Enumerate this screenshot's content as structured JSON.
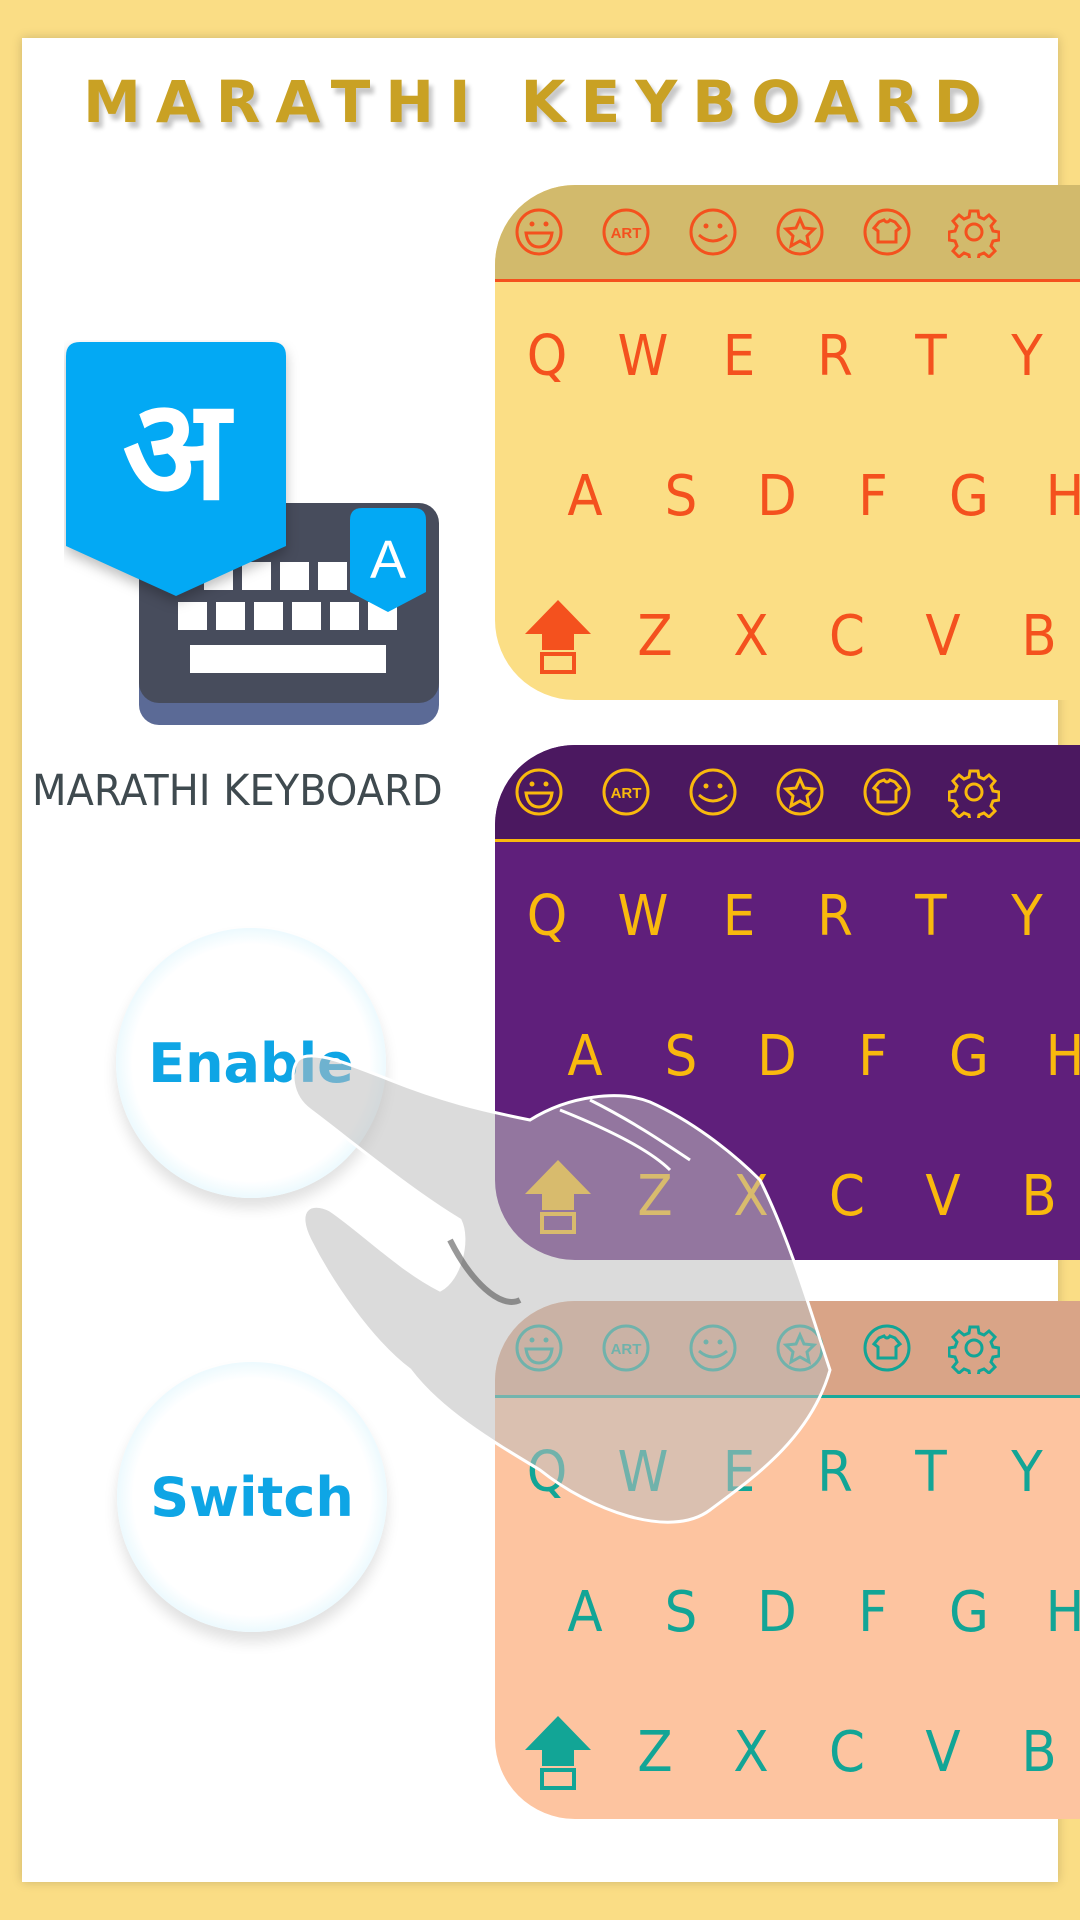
{
  "header": {
    "title": "MARATHI KEYBOARD"
  },
  "app": {
    "name": "MARATHI KEYBOARD",
    "logo": {
      "devanagari_glyph": "अ",
      "latin_glyph": "A"
    }
  },
  "buttons": {
    "enable": "Enable",
    "switch": "Switch"
  },
  "keyboard_toolbar_icons": [
    "emoji-grin-icon",
    "art-icon",
    "smiley-icon",
    "star-icon",
    "tshirt-theme-icon",
    "gear-icon"
  ],
  "keyboard_toolbar_labels": {
    "art": "ART"
  },
  "keyboard_rows": {
    "row1": [
      "Q",
      "W",
      "E",
      "R",
      "T",
      "Y"
    ],
    "row2": [
      "A",
      "S",
      "D",
      "F",
      "G",
      "H"
    ],
    "row3": [
      "Z",
      "X",
      "C",
      "V",
      "B"
    ]
  },
  "themes": [
    {
      "name": "yellow",
      "background": "#fbde85",
      "toolbar": "#d2ba6c",
      "accent": "#f4511e"
    },
    {
      "name": "purple",
      "background": "#5f1f7b",
      "toolbar": "#4b1860",
      "accent": "#f9b90d"
    },
    {
      "name": "peach",
      "background": "#fdc4a0",
      "toolbar": "#d9a487",
      "accent": "#12a596"
    }
  ],
  "colors": {
    "frame": "#fadd85",
    "title": "#c9a124",
    "button_text": "#0ea5e5",
    "logo_blue": "#03a9f4",
    "logo_dark": "#474c5c"
  }
}
